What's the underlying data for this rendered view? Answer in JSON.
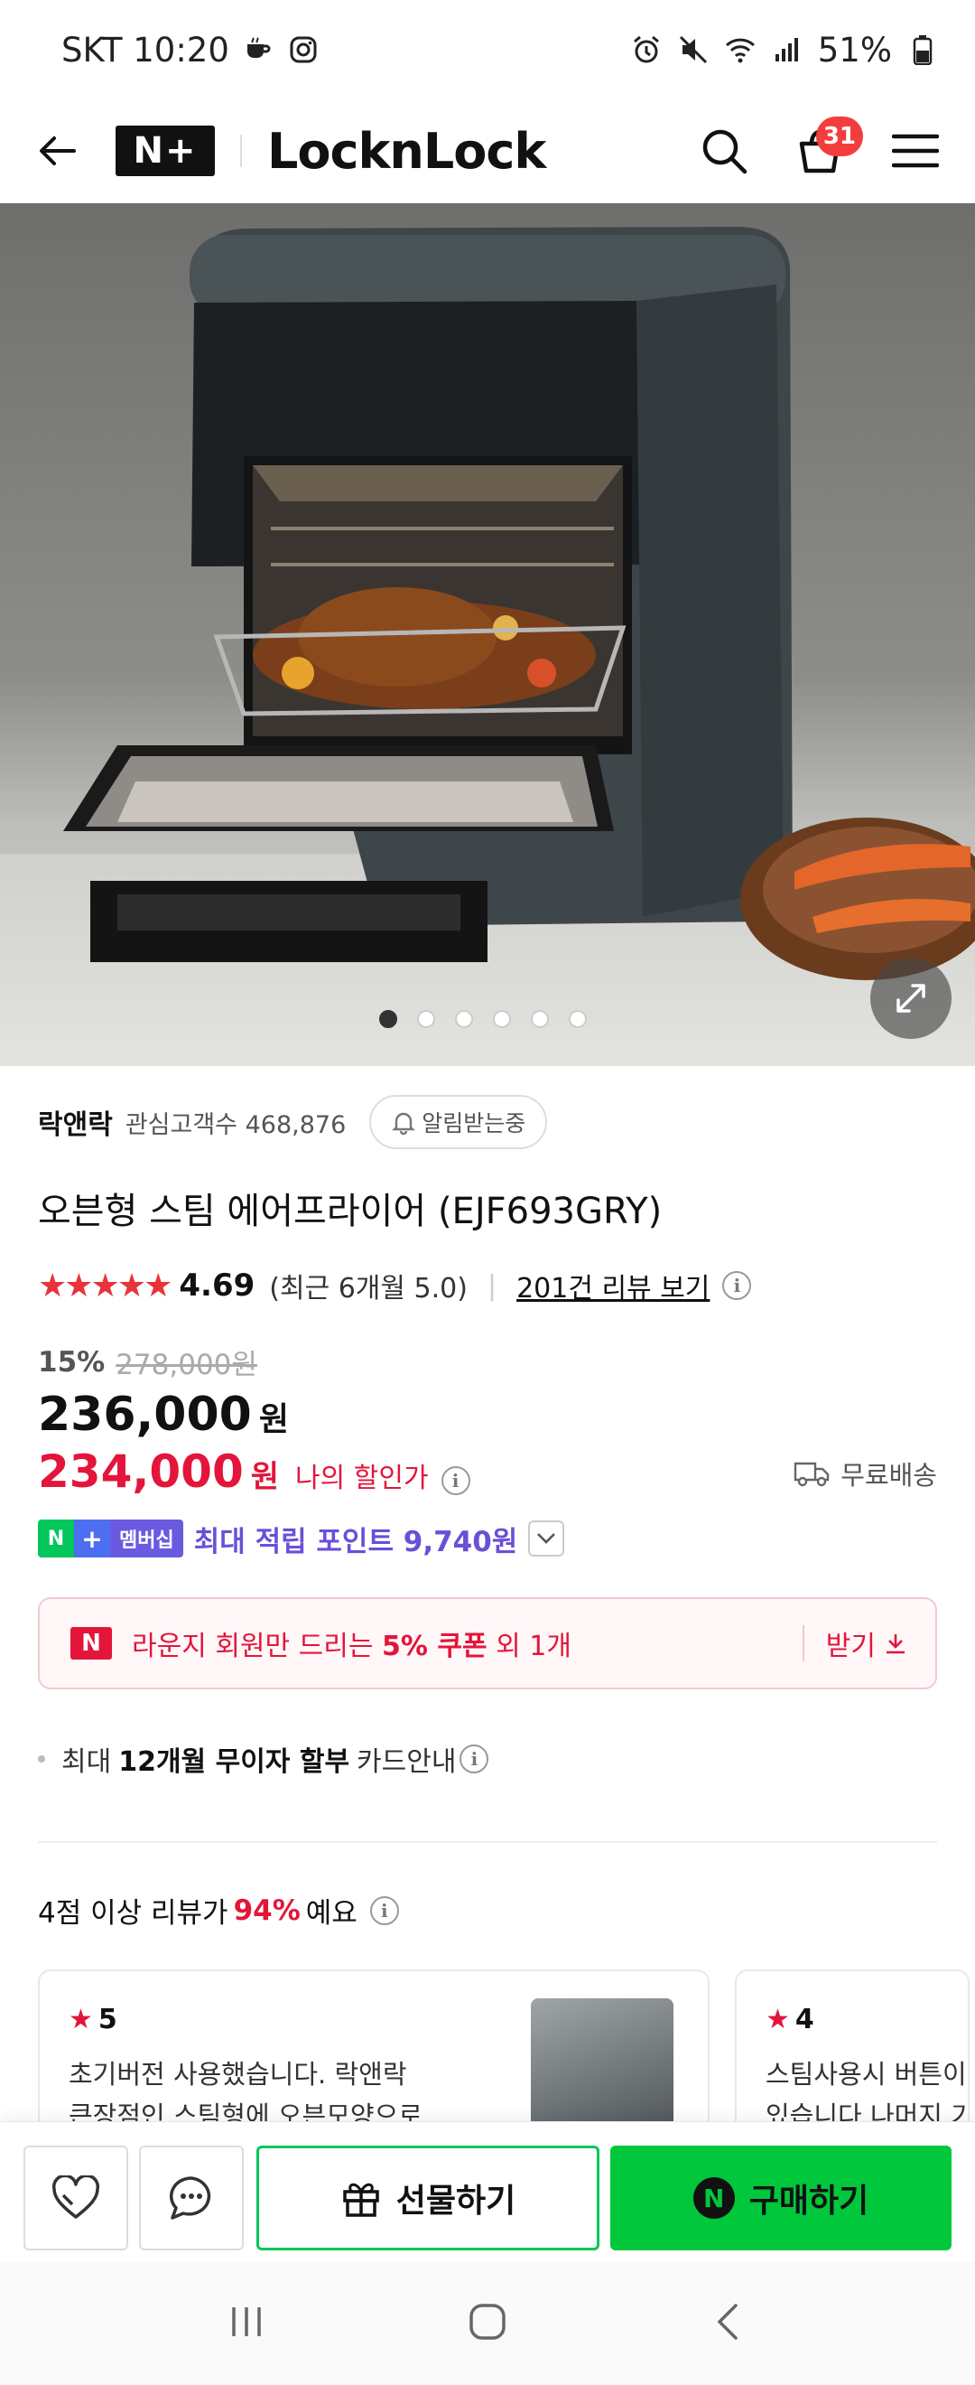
{
  "status_bar": {
    "carrier_time": "SKT 10:20",
    "battery": "51%"
  },
  "header": {
    "logo_text": "N+",
    "brand": "LocknLock",
    "cart_count": "31"
  },
  "gallery": {
    "image_count": 6,
    "active_index": 0
  },
  "product": {
    "seller": "락앤락",
    "interest_label": "관심고객수 468,876",
    "alarm_label": "알림받는중",
    "title": "오븐형 스팀 에어프라이어 (EJF693GRY)",
    "rating": "4.69",
    "stars": "★★★★★",
    "recent_rating": "(최근 6개월 5.0)",
    "review_link": "201건 리뷰 보기",
    "discount_pct": "15%",
    "original_price": "278,000원",
    "sale_price": "236,000",
    "currency": "원",
    "my_price": "234,000",
    "my_price_label": "나의 할인가",
    "delivery": "무료배송",
    "membership_label": "멤버십",
    "point_text": "최대 적립 포인트 9,740원"
  },
  "coupon": {
    "badge": "N",
    "text_before": "라운지 회원만 드리는 ",
    "text_bold": "5% 쿠폰",
    "text_after": " 외 1개",
    "get_label": "받기"
  },
  "installment": {
    "prefix": "최대",
    "bold": "12개월 무이자 할부",
    "suffix": "카드안내"
  },
  "review_summary": {
    "prefix": "4점 이상 리뷰가",
    "percent": "94%",
    "suffix": "예요"
  },
  "reviews": [
    {
      "score": "5",
      "line1": "초기버전 사용했습니다. 락앤락",
      "line2": "큰장점인 스팀형에 오븐모양으로..."
    },
    {
      "score": "4",
      "line1": "스팀사용시 버튼이",
      "line2": "있습니다 나머지 기"
    }
  ],
  "buy_bar": {
    "gift_label": "선물하기",
    "buy_label": "구매하기",
    "npay_mark": "N"
  },
  "colors": {
    "accent_red": "#e3153a",
    "naver_green": "#03c75a",
    "point_purple": "#6a4fd8"
  }
}
